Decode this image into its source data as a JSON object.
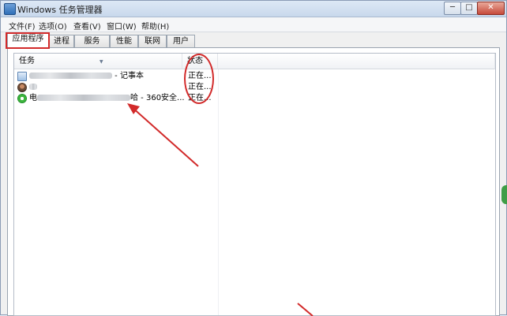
{
  "window": {
    "title": "Windows 任务管理器",
    "controls": {
      "minimize": "─",
      "maximize": "□",
      "close": "✕"
    }
  },
  "menu": [
    "文件(F)",
    "选项(O)",
    "查看(V)",
    "窗口(W)",
    "帮助(H)"
  ],
  "tabs": [
    "应用程序",
    "进程",
    "服务",
    "性能",
    "联网",
    "用户"
  ],
  "active_tab": "应用程序",
  "list": {
    "columns": {
      "task": "任务",
      "status": "状态"
    },
    "rows": [
      {
        "icon": "notepad-icon",
        "suffix": " - 记事本",
        "status": "正在..."
      },
      {
        "icon": "avatar-icon",
        "suffix": "",
        "status": "正在..."
      },
      {
        "icon": "360-browser-icon",
        "prefix": "电",
        "suffix": "哈 - 360安全...",
        "status": "正在..."
      }
    ]
  },
  "colors": {
    "annotation": "#d22a2a",
    "title_bar": "#c8d8ec",
    "accent_green": "#3f9d46"
  }
}
